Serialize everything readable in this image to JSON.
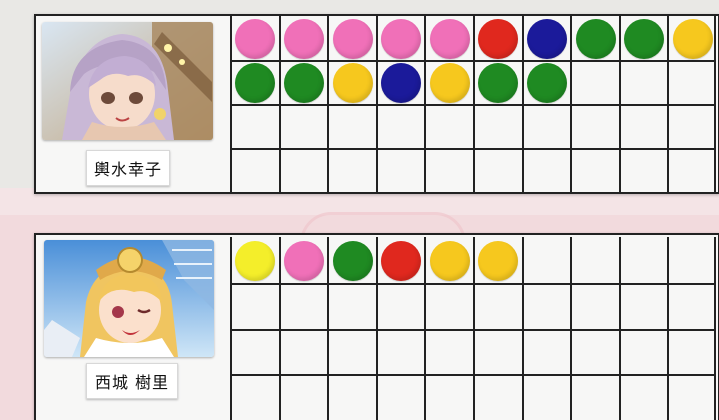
{
  "colors": {
    "pink": "#f070b8",
    "red": "#e0281e",
    "navy": "#1b1a9a",
    "green": "#1f8a22",
    "yellow": "#f6c81e",
    "lemon": "#f4ee2a"
  },
  "boards": [
    {
      "name": "輿水幸子",
      "columns": 10,
      "rows": 4,
      "stickers": [
        [
          "pink",
          "pink",
          "pink",
          "pink",
          "pink",
          "red",
          "navy",
          "green",
          "green",
          "yellow"
        ],
        [
          "green",
          "green",
          "yellow",
          "navy",
          "yellow",
          "green",
          "green"
        ],
        [],
        []
      ]
    },
    {
      "name": "西城 樹里",
      "columns": 10,
      "rows": 4,
      "stickers": [
        [
          "lemon",
          "pink",
          "green",
          "red",
          "yellow",
          "yellow"
        ],
        [],
        [],
        []
      ]
    }
  ]
}
